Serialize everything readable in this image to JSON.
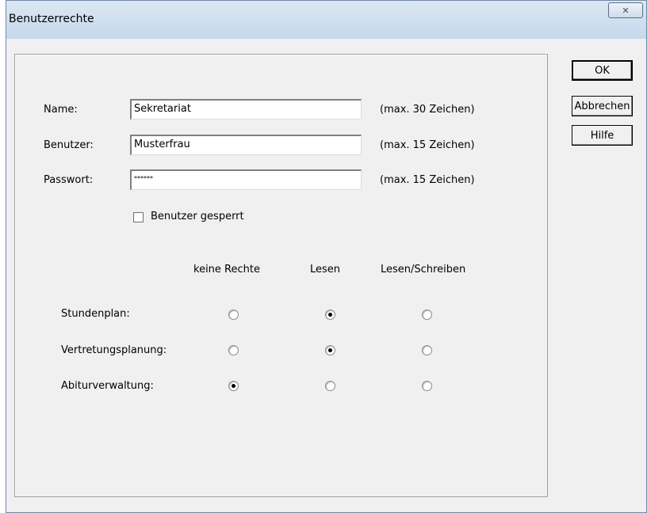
{
  "window": {
    "title": "Benutzerrechte",
    "close_label": "✕"
  },
  "form": {
    "name_label": "Name:",
    "name_value": "Sekretariat",
    "name_hint": "(max. 30 Zeichen)",
    "user_label": "Benutzer:",
    "user_value": "Musterfrau",
    "user_hint": "(max. 15 Zeichen)",
    "password_label": "Passwort:",
    "password_value": "******",
    "password_hint": "(max. 15 Zeichen)",
    "locked_label": "Benutzer gesperrt",
    "locked_checked": false
  },
  "rights": {
    "columns": [
      "keine Rechte",
      "Lesen",
      "Lesen/Schreiben"
    ],
    "rows": [
      {
        "label": "Stundenplan:",
        "selected": 1
      },
      {
        "label": "Vertretungsplanung:",
        "selected": 1
      },
      {
        "label": "Abiturverwaltung:",
        "selected": 0
      }
    ]
  },
  "buttons": {
    "ok": "OK",
    "cancel": "Abbrechen",
    "help": "Hilfe"
  }
}
